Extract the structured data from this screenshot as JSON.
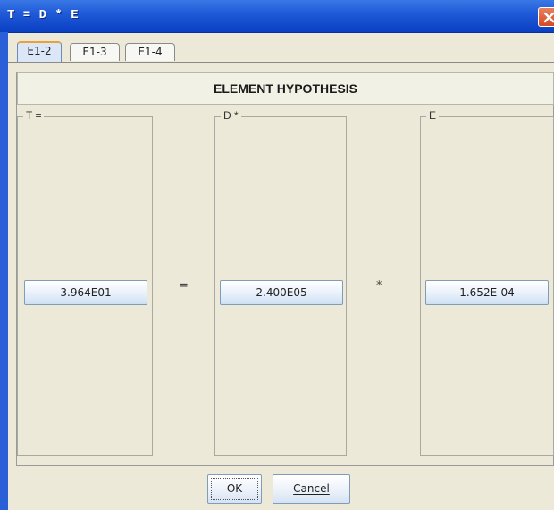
{
  "window": {
    "title": "T = D * E"
  },
  "tabs": [
    {
      "label": "E1-2",
      "active": true
    },
    {
      "label": "E1-3",
      "active": false
    },
    {
      "label": "E1-4",
      "active": false
    }
  ],
  "header": {
    "title": "ELEMENT HYPOTHESIS"
  },
  "groups": [
    {
      "label": "T =",
      "value": "3.964E01"
    },
    {
      "label": "D *",
      "value": "2.400E05"
    },
    {
      "label": "E",
      "value": "1.652E-04"
    }
  ],
  "operators": {
    "equals": "=",
    "times": "*"
  },
  "buttons": {
    "ok": "OK",
    "cancel": "Cancel"
  },
  "colors": {
    "titlebar": "#1f5bd8",
    "close": "#d44a22",
    "background": "#ece9d8",
    "active_tab_accent": "#e9a23a"
  }
}
